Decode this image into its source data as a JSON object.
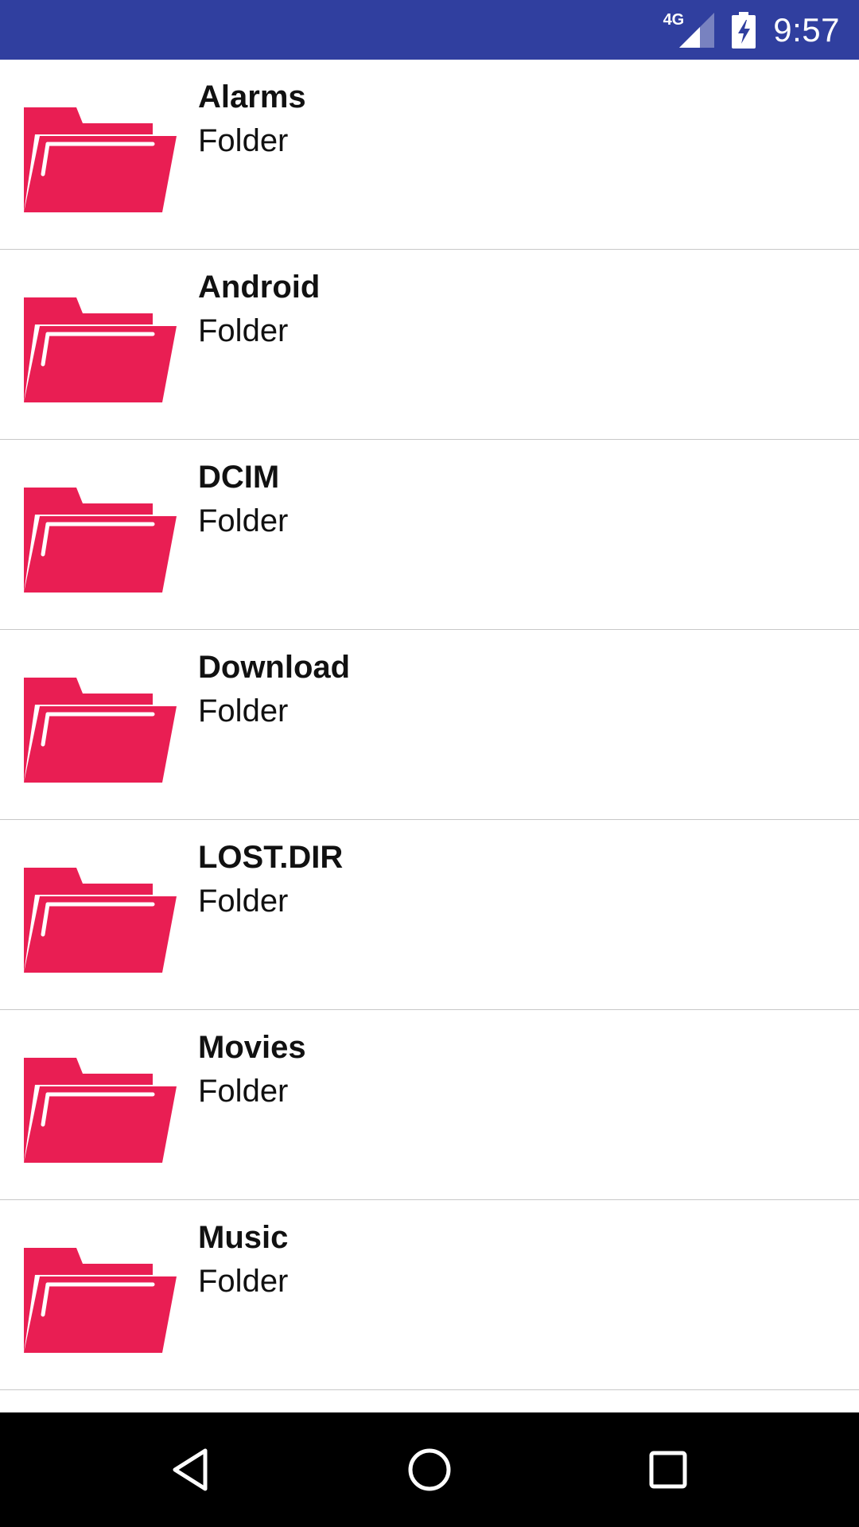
{
  "status_bar": {
    "network_label": "4G",
    "time": "9:57",
    "icons": [
      "signal-icon",
      "battery-charging-icon"
    ],
    "background_color": "#303f9f"
  },
  "folder_color": "#e91e53",
  "folders": [
    {
      "name": "Alarms",
      "type": "Folder"
    },
    {
      "name": "Android",
      "type": "Folder"
    },
    {
      "name": "DCIM",
      "type": "Folder"
    },
    {
      "name": "Download",
      "type": "Folder"
    },
    {
      "name": "LOST.DIR",
      "type": "Folder"
    },
    {
      "name": "Movies",
      "type": "Folder"
    },
    {
      "name": "Music",
      "type": "Folder"
    }
  ],
  "nav_bar": {
    "icons": [
      "back-icon",
      "home-icon",
      "recents-icon"
    ]
  }
}
